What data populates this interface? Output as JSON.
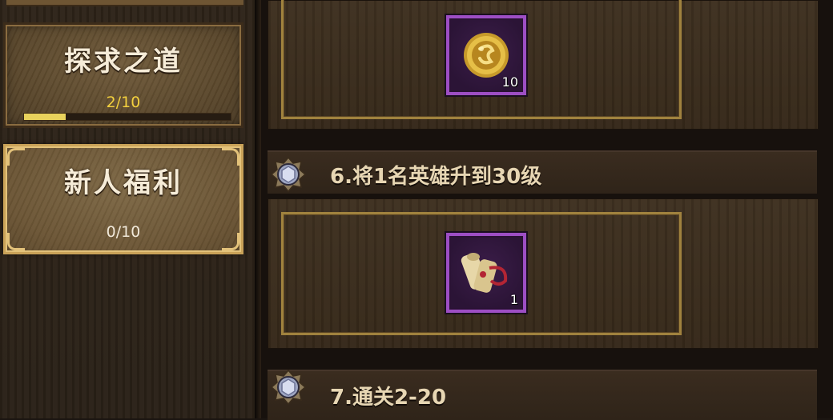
{
  "sidebar": {
    "tabs": [
      {
        "title": "探求之道",
        "count": "2/10",
        "progress": 0.2
      },
      {
        "title": "新人福利",
        "count": "0/10"
      }
    ]
  },
  "tasks": [
    {
      "title": "6.将1名英雄升到30级",
      "reward": {
        "name": "scroll",
        "qty": "1"
      }
    },
    {
      "title": "7.通关2-20"
    }
  ],
  "top_reward": {
    "name": "gold-coin",
    "qty": "10"
  },
  "colors": {
    "accent_gold": "#e3c27a",
    "count_yellow": "#f3d03e",
    "item_border_purple": "#9d4ec4"
  }
}
